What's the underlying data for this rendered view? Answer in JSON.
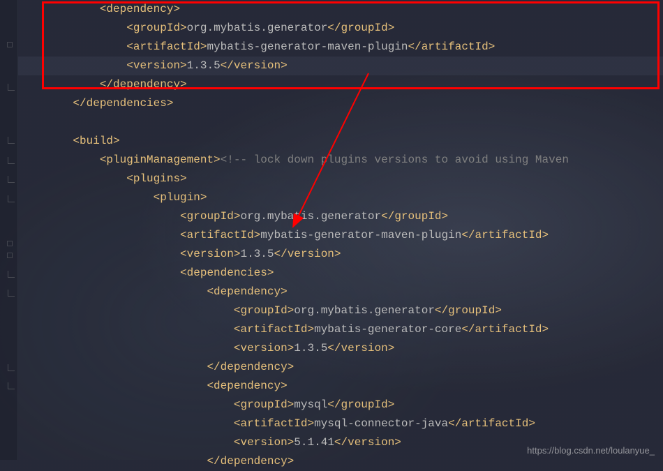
{
  "lines": [
    {
      "indent": 3,
      "parts": [
        {
          "t": "tag",
          "v": "<dependency>"
        }
      ]
    },
    {
      "indent": 4,
      "parts": [
        {
          "t": "tag",
          "v": "<groupId>"
        },
        {
          "t": "text",
          "v": "org.mybatis.generator"
        },
        {
          "t": "tag",
          "v": "</groupId>"
        }
      ]
    },
    {
      "indent": 4,
      "parts": [
        {
          "t": "tag",
          "v": "<artifactId>"
        },
        {
          "t": "text",
          "v": "mybatis-generator-maven-plugin"
        },
        {
          "t": "tag",
          "v": "</artifactId>"
        }
      ]
    },
    {
      "indent": 4,
      "hl": true,
      "parts": [
        {
          "t": "tag",
          "v": "<version>"
        },
        {
          "t": "text",
          "v": "1.3.5"
        },
        {
          "t": "tag",
          "v": "</version>"
        }
      ]
    },
    {
      "indent": 3,
      "parts": [
        {
          "t": "tag",
          "v": "</dependency>"
        }
      ]
    },
    {
      "indent": 2,
      "parts": [
        {
          "t": "tag",
          "v": "</dependencies>"
        }
      ]
    },
    {
      "indent": 0,
      "parts": []
    },
    {
      "indent": 2,
      "parts": [
        {
          "t": "tag",
          "v": "<build>"
        }
      ]
    },
    {
      "indent": 3,
      "parts": [
        {
          "t": "tag",
          "v": "<pluginManagement>"
        },
        {
          "t": "comment",
          "v": "<!-- lock down plugins versions to avoid using Maven"
        }
      ]
    },
    {
      "indent": 4,
      "parts": [
        {
          "t": "tag",
          "v": "<plugins>"
        }
      ]
    },
    {
      "indent": 5,
      "parts": [
        {
          "t": "tag",
          "v": "<plugin>"
        }
      ]
    },
    {
      "indent": 6,
      "parts": [
        {
          "t": "tag",
          "v": "<groupId>"
        },
        {
          "t": "text",
          "v": "org.mybatis.generator"
        },
        {
          "t": "tag",
          "v": "</groupId>"
        }
      ]
    },
    {
      "indent": 6,
      "parts": [
        {
          "t": "tag",
          "v": "<artifactId>"
        },
        {
          "t": "text",
          "v": "mybatis-generator-maven-plugin"
        },
        {
          "t": "tag",
          "v": "</artifactId>"
        }
      ]
    },
    {
      "indent": 6,
      "parts": [
        {
          "t": "tag",
          "v": "<version>"
        },
        {
          "t": "text",
          "v": "1.3.5"
        },
        {
          "t": "tag",
          "v": "</version>"
        }
      ]
    },
    {
      "indent": 6,
      "parts": [
        {
          "t": "tag",
          "v": "<dependencies>"
        }
      ]
    },
    {
      "indent": 7,
      "parts": [
        {
          "t": "tag",
          "v": "<dependency>"
        }
      ]
    },
    {
      "indent": 8,
      "parts": [
        {
          "t": "tag",
          "v": "<groupId>"
        },
        {
          "t": "text",
          "v": "org.mybatis.generator"
        },
        {
          "t": "tag",
          "v": "</groupId>"
        }
      ]
    },
    {
      "indent": 8,
      "parts": [
        {
          "t": "tag",
          "v": "<artifactId>"
        },
        {
          "t": "text",
          "v": "mybatis-generator-core"
        },
        {
          "t": "tag",
          "v": "</artifactId>"
        }
      ]
    },
    {
      "indent": 8,
      "parts": [
        {
          "t": "tag",
          "v": "<version>"
        },
        {
          "t": "text",
          "v": "1.3.5"
        },
        {
          "t": "tag",
          "v": "</version>"
        }
      ]
    },
    {
      "indent": 7,
      "parts": [
        {
          "t": "tag",
          "v": "</dependency>"
        }
      ]
    },
    {
      "indent": 7,
      "parts": [
        {
          "t": "tag",
          "v": "<dependency>"
        }
      ]
    },
    {
      "indent": 8,
      "parts": [
        {
          "t": "tag",
          "v": "<groupId>"
        },
        {
          "t": "text",
          "v": "mysql"
        },
        {
          "t": "tag",
          "v": "</groupId>"
        }
      ]
    },
    {
      "indent": 8,
      "parts": [
        {
          "t": "tag",
          "v": "<artifactId>"
        },
        {
          "t": "text",
          "v": "mysql-connector-java"
        },
        {
          "t": "tag",
          "v": "</artifactId>"
        }
      ]
    },
    {
      "indent": 8,
      "parts": [
        {
          "t": "tag",
          "v": "<version>"
        },
        {
          "t": "text",
          "v": "5.1.41"
        },
        {
          "t": "tag",
          "v": "</version>"
        }
      ]
    },
    {
      "indent": 7,
      "parts": [
        {
          "t": "tag",
          "v": "</dependency>"
        }
      ]
    }
  ],
  "indentUnit": "    ",
  "basePad": " ",
  "watermark": "https://blog.csdn.net/loulanyue_",
  "foldMarkers": [
    120,
    196,
    225,
    252,
    280,
    388,
    415,
    522,
    548
  ],
  "foldSquares": [
    60,
    345,
    362
  ]
}
